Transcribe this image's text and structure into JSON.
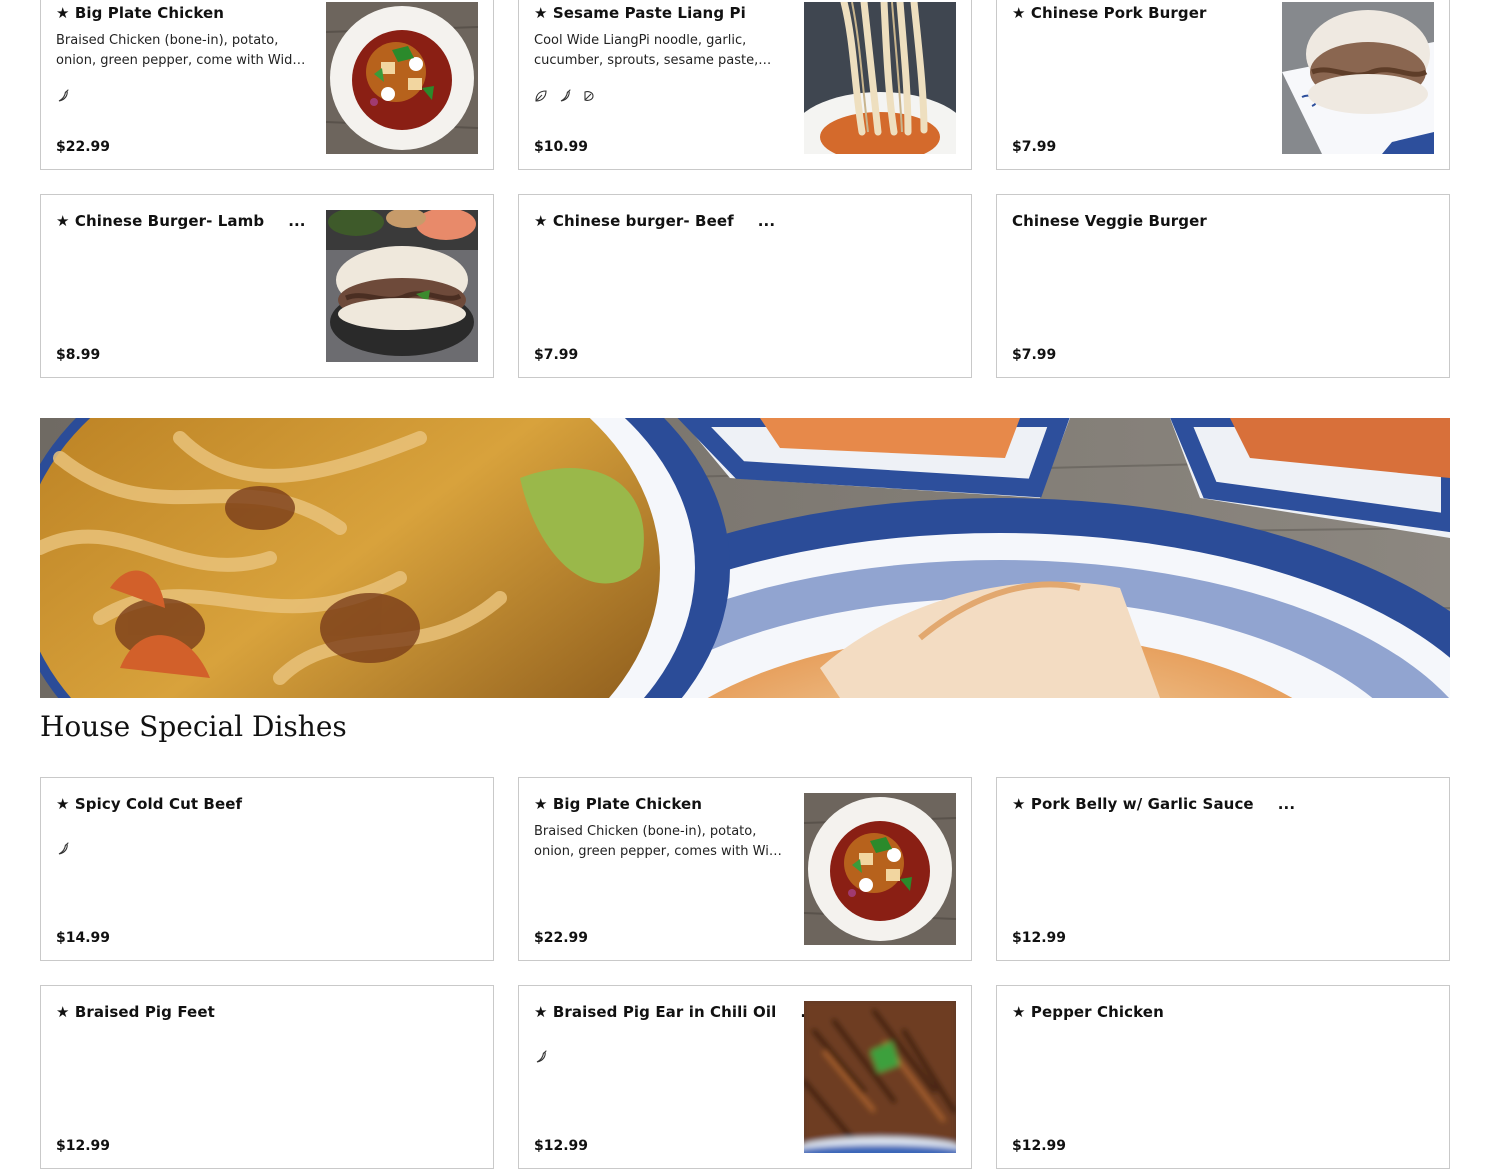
{
  "top_items": [
    {
      "name": "★ Big Plate Chicken",
      "desc": "Braised Chicken (bone-in), potato, onion, green pepper, come with Wide noodle",
      "price": "$22.99",
      "icons": [
        "chili-icon"
      ],
      "image": "plate-chicken"
    },
    {
      "name": "★ Sesame Paste Liang Pi",
      "desc": "Cool Wide LiangPi noodle, garlic, cucumber, sprouts, sesame paste, chili oil",
      "price": "$10.99",
      "icons": [
        "leaf-icon",
        "chili-icon",
        "vegan-icon"
      ],
      "image": "liang-pi"
    },
    {
      "name": "★ Chinese Pork Burger",
      "desc": "",
      "price": "$7.99",
      "icons": [],
      "image": "pork-burger"
    },
    {
      "name": "★ Chinese Burger- Lamb",
      "more": "...",
      "desc": "",
      "price": "$8.99",
      "icons": [],
      "image": "lamb-burger"
    },
    {
      "name": "★ Chinese burger- Beef",
      "more": "...",
      "desc": "",
      "price": "$7.99",
      "icons": [],
      "image": ""
    },
    {
      "name": "Chinese Veggie Burger",
      "desc": "",
      "price": "$7.99",
      "icons": [],
      "image": ""
    }
  ],
  "section": {
    "title": "House Special Dishes"
  },
  "house_items": [
    {
      "name": "★ Spicy Cold Cut Beef",
      "desc": "",
      "price": "$14.99",
      "icons": [
        "chili-icon"
      ],
      "image": ""
    },
    {
      "name": "★ Big Plate Chicken",
      "desc": "Braised Chicken (bone-in), potato, onion, green pepper, comes with Wide noodle",
      "price": "$22.99",
      "icons": [],
      "image": "plate-chicken"
    },
    {
      "name": "★ Pork Belly w/ Garlic Sauce",
      "more": "...",
      "desc": "",
      "price": "$12.99",
      "icons": [],
      "image": ""
    },
    {
      "name": "★ Braised Pig Feet",
      "desc": "",
      "price": "$12.99",
      "icons": [],
      "image": ""
    },
    {
      "name": "★ Braised Pig Ear in Chili Oil",
      "more": "...",
      "desc": "",
      "price": "$12.99",
      "icons": [
        "chili-icon"
      ],
      "image": "pig-ear"
    },
    {
      "name": "★ Pepper Chicken",
      "desc": "",
      "price": "$12.99",
      "icons": [],
      "image": ""
    }
  ]
}
